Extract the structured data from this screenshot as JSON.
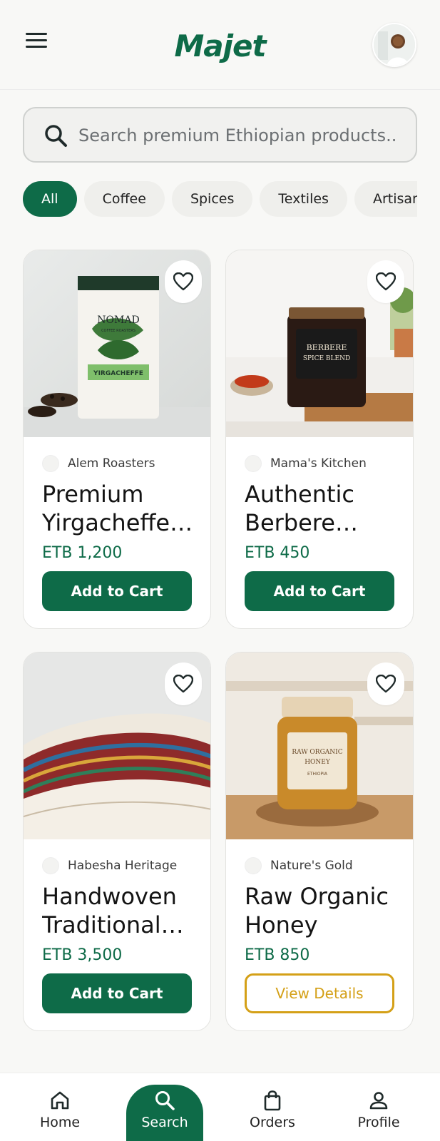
{
  "header": {
    "logo": "Majet",
    "menu_icon": "hamburger-menu-icon",
    "avatar_icon": "profile-avatar"
  },
  "search": {
    "placeholder": "Search premium Ethiopian products..",
    "icon": "search-icon"
  },
  "categories": [
    {
      "label": "All",
      "active": true
    },
    {
      "label": "Coffee",
      "active": false
    },
    {
      "label": "Spices",
      "active": false
    },
    {
      "label": "Textiles",
      "active": false
    },
    {
      "label": "Artisan",
      "active": false
    }
  ],
  "products": [
    {
      "vendor": "Alem Roasters",
      "title_line1": "Premium",
      "title_line2": "Yirgacheffe…",
      "price": "ETB 1,200",
      "action": "Add to Cart",
      "action_style": "primary"
    },
    {
      "vendor": "Mama's Kitchen",
      "title_line1": "Authentic",
      "title_line2": "Berbere…",
      "price": "ETB 450",
      "action": "Add to Cart",
      "action_style": "primary"
    },
    {
      "vendor": "Habesha Heritage",
      "title_line1": "Handwoven",
      "title_line2": "Traditional…",
      "price": "ETB 3,500",
      "action": "Add to Cart",
      "action_style": "primary"
    },
    {
      "vendor": "Nature's Gold",
      "title_line1": "Raw Organic",
      "title_line2": "Honey",
      "price": "ETB 850",
      "action": "View Details",
      "action_style": "outline"
    }
  ],
  "product_images": {
    "p0_brand": "NOMAD",
    "p0_sub": "COFFEE ROASTERS",
    "p0_origin": "YIRGACHEFFE",
    "p1_label1": "BERBERE",
    "p1_label2": "SPICE BLEND",
    "p3_label1": "RAW ORGANIC",
    "p3_label2": "HONEY",
    "p3_label3": "ETHIOPIA"
  },
  "nav": [
    {
      "label": "Home",
      "icon": "home-icon",
      "active": false
    },
    {
      "label": "Search",
      "icon": "search-icon",
      "active": true
    },
    {
      "label": "Orders",
      "icon": "shopping-bag-icon",
      "active": false
    },
    {
      "label": "Profile",
      "icon": "person-icon",
      "active": false
    }
  ],
  "colors": {
    "brand_green": "#0e6b48",
    "accent_gold": "#d4a017",
    "background": "#f8f8f6"
  }
}
